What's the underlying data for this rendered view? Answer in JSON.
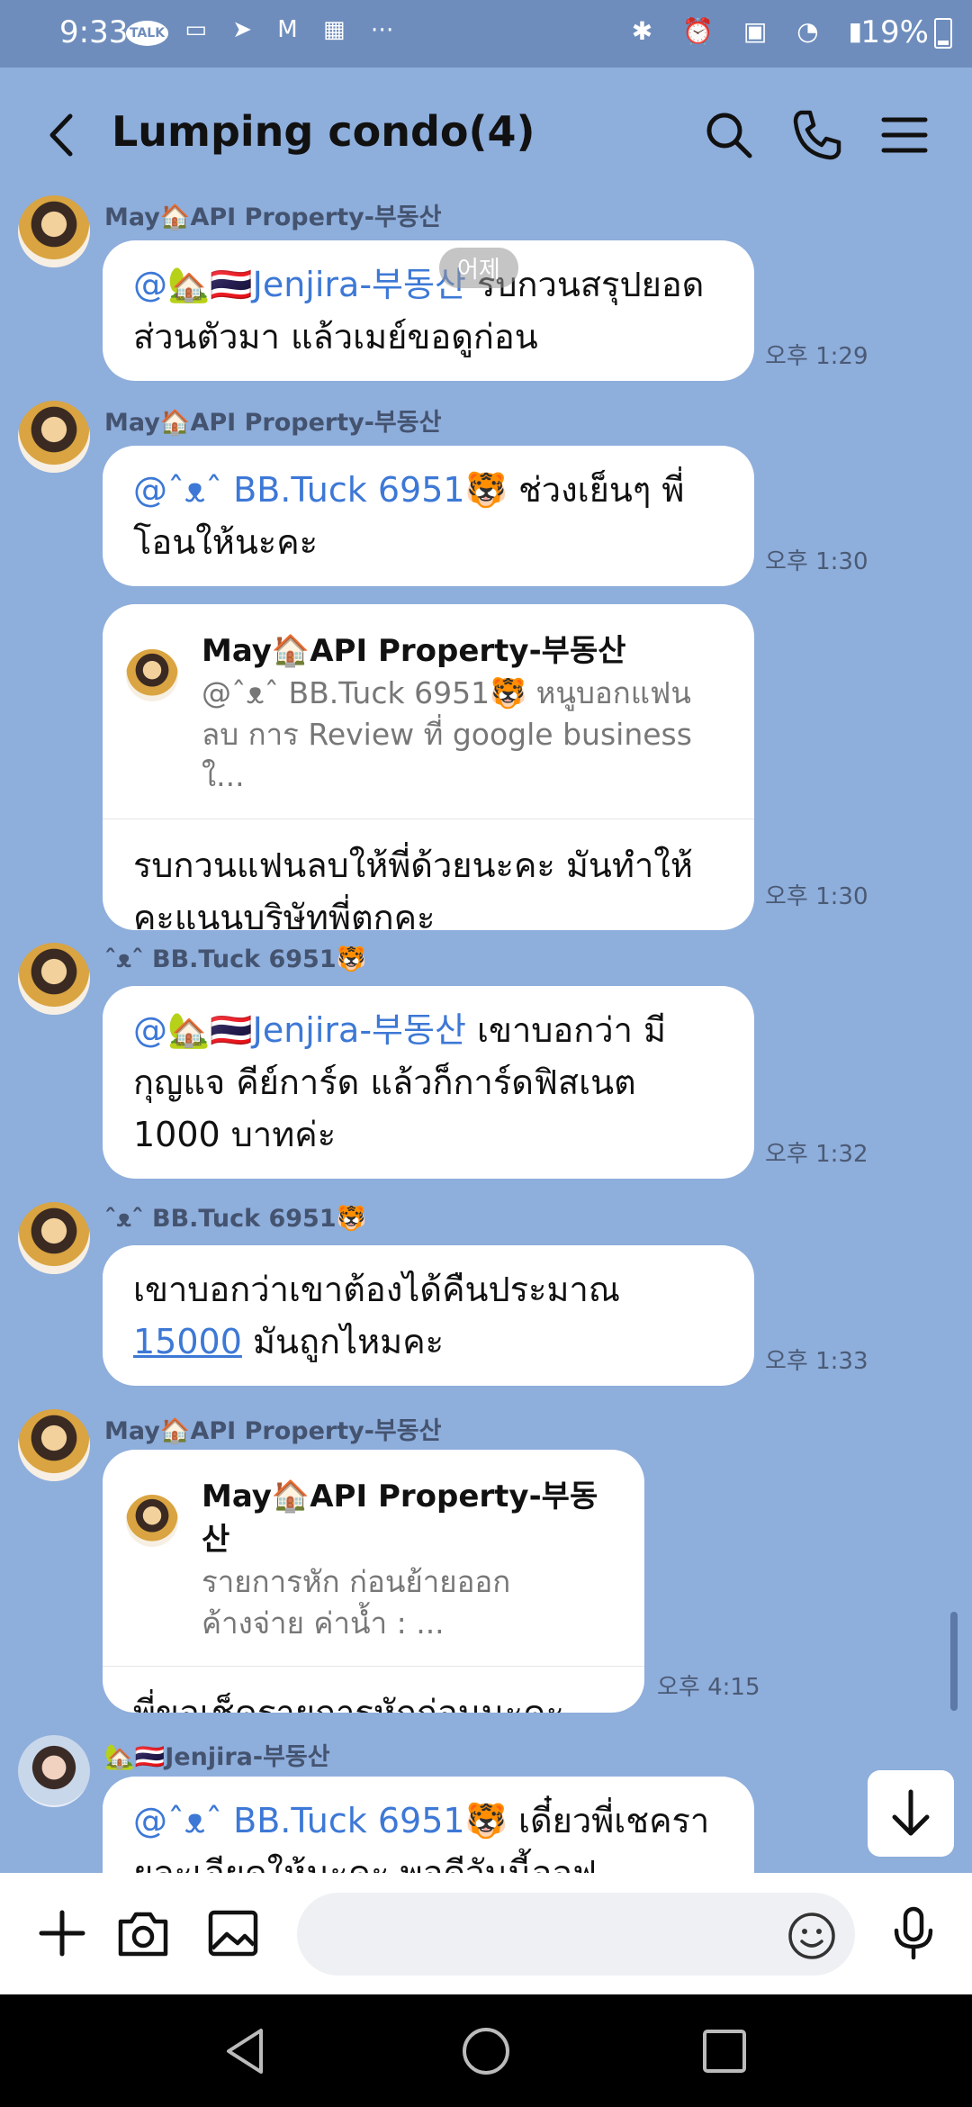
{
  "status_bar": {
    "time": "9:33",
    "left_icons": [
      "talk-icon",
      "message-icon",
      "telegram-icon",
      "gmail-icon",
      "temu-icon",
      "more-icon"
    ],
    "left_texts": [
      "TALK",
      "⋯"
    ],
    "battery": "19%",
    "right_icons": [
      "bluetooth-icon",
      "alarm-icon",
      "hd-icon",
      "wifi-icon",
      "signal-icon"
    ]
  },
  "header": {
    "title": "Lumping condo(4)"
  },
  "date_pill": "어제",
  "messages": [
    {
      "sender": "May🏠API Property-부동산",
      "mention": "@🏡🇹🇭Jenjira-부동산",
      "text": " รบกวนสรุปยอดส่วนตัวมา แล้วเมย์ขอดูก่อน",
      "time": "오후 1:29"
    },
    {
      "sender": "May🏠API Property-부동산",
      "mention": "@ˆᴥˆ BB.Tuck 6951🐯",
      "text": " ช่วงเย็นๆ พี่โอนให้นะคะ",
      "time": "오후 1:30"
    },
    {
      "reply_name": "May🏠API Property-부동산",
      "reply_text": "@ˆᴥˆ BB.Tuck 6951🐯 หนูบอกแฟนลบ การ Review ที่ google business ใ...",
      "text": "รบกวนแฟนลบให้พี่ด้วยนะคะ มันทำให้คะแนนบริษัทพี่ตกคะ",
      "time": "오후 1:30"
    },
    {
      "sender": "ˆᴥˆ BB.Tuck 6951🐯",
      "mention": "@🏡🇹🇭Jenjira-부동산",
      "text": " เขาบอกว่า มีกุญแจ คีย์การ์ด แล้วก็การ์ดฟิสเนต 1000 บาทค่ะ",
      "time": "오후 1:32"
    },
    {
      "sender": "ˆᴥˆ BB.Tuck 6951🐯",
      "text_before": "เขาบอกว่าเขาต้องได้คืนประมาณ ",
      "link": "15000",
      "text_after": " มันถูกไหมคะ",
      "time": "오후 1:33"
    },
    {
      "sender": "May🏠API Property-부동산",
      "reply_name": "May🏠API Property-부동산",
      "reply_text": "รายการหัก ก่อนย้ายออก\nค้างจ่าย ค่าน้ำ : ...",
      "text": "พี่ขอเช็ครายการหักก่อนนะคะ",
      "time": "오후 4:15"
    },
    {
      "sender": "🏡🇹🇭Jenjira-부동산",
      "mention": "@ˆᴥˆ BB.Tuck 6951🐯",
      "text": " เดี๋ยวพี่เชครายละเอียดให้นะคะ พอดีวันนี้ออฟ"
    }
  ],
  "input": {
    "placeholder": ""
  },
  "colors": {
    "chat_background": "#8eaedc",
    "bubble": "#ffffff",
    "mention": "#3d78d6"
  }
}
